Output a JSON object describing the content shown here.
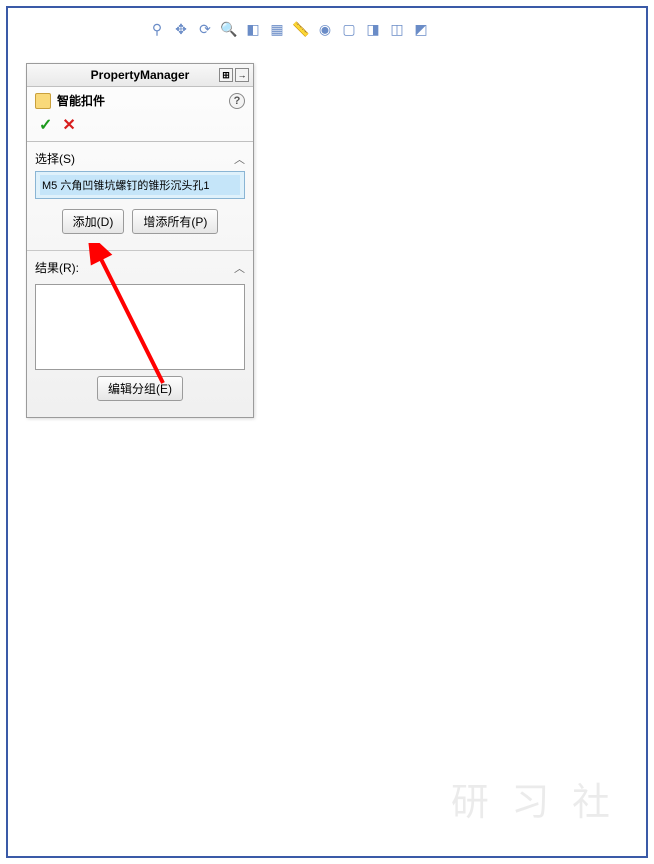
{
  "panel": {
    "title": "PropertyManager",
    "feature_name": "智能扣件",
    "help_label": "?",
    "sections": {
      "selection": {
        "label": "选择(S)",
        "items": [
          "M5 六角凹锥坑螺钉的锥形沉头孔1"
        ]
      },
      "results": {
        "label": "结果(R):"
      }
    },
    "buttons": {
      "add": "添加(D)",
      "add_all": "增添所有(P)",
      "edit_group": "编辑分组(E)"
    }
  },
  "watermark": "研 习 社",
  "colors": {
    "green_ok": "#1d9a1d",
    "red_x": "#d81e1e",
    "sel_bg": "#dff1fb",
    "sel_item": "#c5e5f9"
  }
}
